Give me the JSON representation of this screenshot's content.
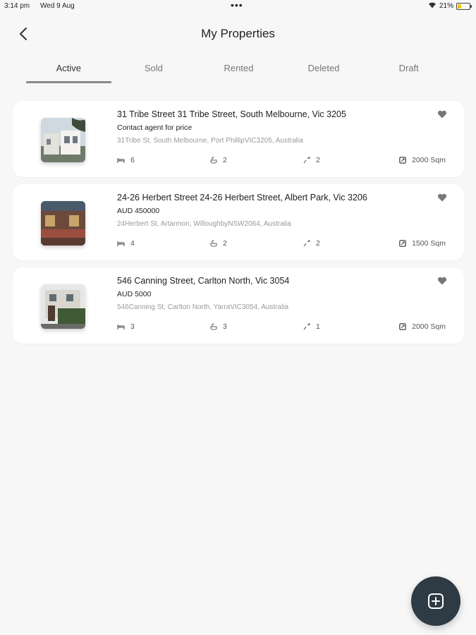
{
  "status_bar": {
    "time": "3:14 pm",
    "date": "Wed 9 Aug",
    "battery_pct": "21%"
  },
  "header": {
    "title": "My Properties"
  },
  "tabs": [
    {
      "label": "Active",
      "active": true
    },
    {
      "label": "Sold",
      "active": false
    },
    {
      "label": "Rented",
      "active": false
    },
    {
      "label": "Deleted",
      "active": false
    },
    {
      "label": "Draft",
      "active": false
    }
  ],
  "properties": [
    {
      "title": "31 Tribe Street 31 Tribe Street, South Melbourne, Vic 3205",
      "price": "Contact agent for price",
      "address": "31Tribe St, South Melbourne, Port PhillipVIC3205, Australia",
      "beds": "6",
      "baths": "2",
      "cars": "2",
      "area": "2000 Sqm"
    },
    {
      "title": "24-26 Herbert Street 24-26 Herbert Street, Albert Park, Vic 3206",
      "price": "AUD 450000",
      "address": "24Herbert St, Artarmon, WilloughbyNSW2064, Australia",
      "beds": "4",
      "baths": "2",
      "cars": "2",
      "area": "1500 Sqm"
    },
    {
      "title": "546 Canning Street, Carlton North, Vic 3054",
      "price": "AUD 5000",
      "address": "546Canning St, Carlton North, YarraVIC3054, Australia",
      "beds": "3",
      "baths": "3",
      "cars": "1",
      "area": "2000 Sqm"
    }
  ],
  "colors": {
    "background": "#f7f7f7",
    "card": "#ffffff",
    "fab": "#2e3a44",
    "battery": "#f0c419"
  },
  "icons": {
    "back": "chevron-left-icon",
    "favorite": "heart-icon",
    "beds": "bed-icon",
    "baths": "bath-icon",
    "cars": "car-icon",
    "area": "area-icon",
    "add": "add-square-icon"
  }
}
